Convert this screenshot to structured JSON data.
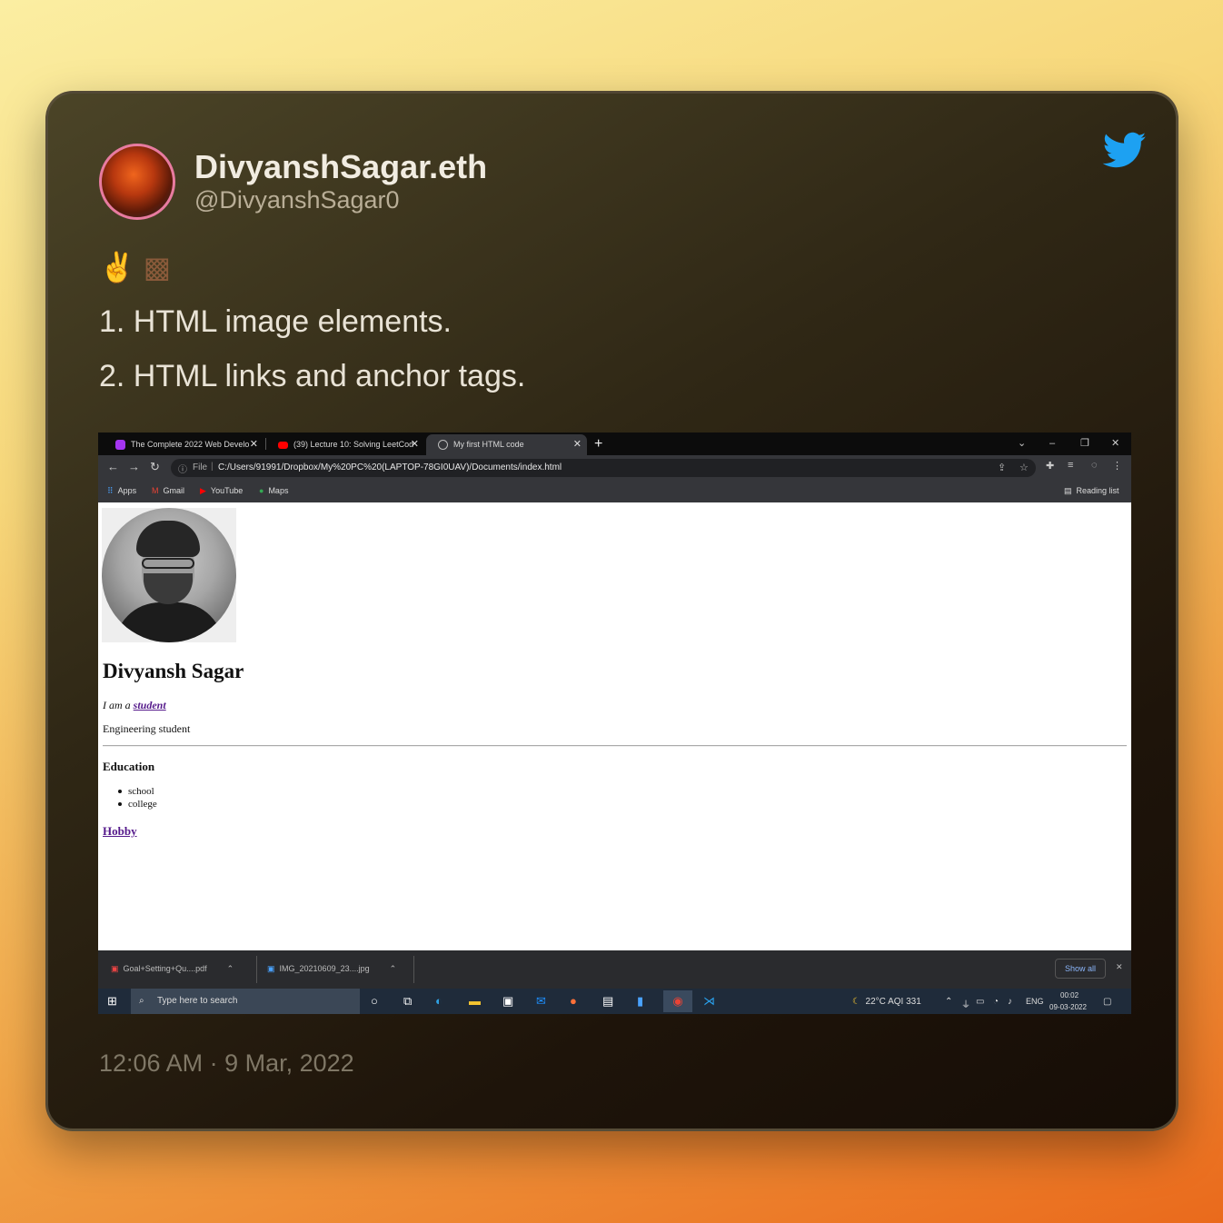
{
  "tweet": {
    "display_name": "DivyanshSagar.eth",
    "handle": "@DivyanshSagar0",
    "emoji": [
      "✌",
      "▩"
    ],
    "line1": "1. HTML image elements.",
    "line2": "2. HTML links and anchor tags.",
    "timestamp": "12:06 AM · 9 Mar, 2022",
    "brand_color": "#1da1f2"
  },
  "browser": {
    "tabs": [
      {
        "label": "The Complete 2022 Web Develo",
        "icon": "udemy-icon",
        "active": false
      },
      {
        "label": "(39) Lecture 10: Solving LeetCod",
        "icon": "youtube-icon",
        "active": false
      },
      {
        "label": "My first HTML code",
        "icon": "globe-icon",
        "active": true
      }
    ],
    "new_tab": "+",
    "omnibox": {
      "file_label": "File",
      "url": "C:/Users/91991/Dropbox/My%20PC%20(LAPTOP-78GI0UAV)/Documents/index.html"
    },
    "bookmarks": [
      {
        "label": "Apps",
        "icon": "apps-icon"
      },
      {
        "label": "Gmail",
        "icon": "gmail-icon"
      },
      {
        "label": "YouTube",
        "icon": "youtube-icon"
      },
      {
        "label": "Maps",
        "icon": "maps-icon"
      }
    ],
    "reading_list": "Reading list"
  },
  "webpage": {
    "heading": "Divyansh Sagar",
    "intro_prefix": "I am a ",
    "intro_link": "student",
    "subtitle": "Engineering student",
    "education_heading": "Education",
    "education_items": [
      "school",
      "college"
    ],
    "hobby_link": "Hobby"
  },
  "downloads": {
    "items": [
      "Goal+Setting+Qu....pdf",
      "IMG_20210609_23....jpg"
    ],
    "show_all": "Show all"
  },
  "taskbar": {
    "search_placeholder": "Type here to search",
    "weather": "22°C  AQI 331",
    "language": "ENG",
    "time": "00:02",
    "date": "09-03-2022"
  }
}
